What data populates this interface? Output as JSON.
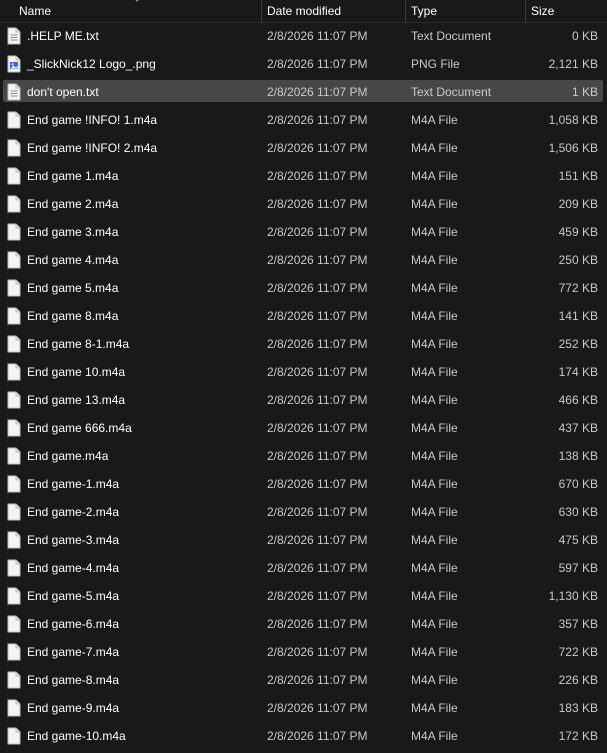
{
  "columns": {
    "name": "Name",
    "date": "Date modified",
    "type": "Type",
    "size": "Size"
  },
  "files": [
    {
      "name": ".HELP ME.txt",
      "date": "2/8/2026 11:07 PM",
      "type": "Text Document",
      "size": "0 KB",
      "icon": "text-file-icon"
    },
    {
      "name": "_SlickNick12 Logo_.png",
      "date": "2/8/2026 11:07 PM",
      "type": "PNG File",
      "size": "2,121 KB",
      "icon": "image-file-icon"
    },
    {
      "name": "don't open.txt",
      "date": "2/8/2026 11:07 PM",
      "type": "Text Document",
      "size": "1 KB",
      "icon": "text-file-icon",
      "selected": true
    },
    {
      "name": "End game !INFO! 1.m4a",
      "date": "2/8/2026 11:07 PM",
      "type": "M4A File",
      "size": "1,058 KB",
      "icon": "file-icon"
    },
    {
      "name": "End game !INFO! 2.m4a",
      "date": "2/8/2026 11:07 PM",
      "type": "M4A File",
      "size": "1,506 KB",
      "icon": "file-icon"
    },
    {
      "name": "End game 1.m4a",
      "date": "2/8/2026 11:07 PM",
      "type": "M4A File",
      "size": "151 KB",
      "icon": "file-icon"
    },
    {
      "name": "End game 2.m4a",
      "date": "2/8/2026 11:07 PM",
      "type": "M4A File",
      "size": "209 KB",
      "icon": "file-icon"
    },
    {
      "name": "End game 3.m4a",
      "date": "2/8/2026 11:07 PM",
      "type": "M4A File",
      "size": "459 KB",
      "icon": "file-icon"
    },
    {
      "name": "End game 4.m4a",
      "date": "2/8/2026 11:07 PM",
      "type": "M4A File",
      "size": "250 KB",
      "icon": "file-icon"
    },
    {
      "name": "End game 5.m4a",
      "date": "2/8/2026 11:07 PM",
      "type": "M4A File",
      "size": "772 KB",
      "icon": "file-icon"
    },
    {
      "name": "End game 8.m4a",
      "date": "2/8/2026 11:07 PM",
      "type": "M4A File",
      "size": "141 KB",
      "icon": "file-icon"
    },
    {
      "name": "End game 8-1.m4a",
      "date": "2/8/2026 11:07 PM",
      "type": "M4A File",
      "size": "252 KB",
      "icon": "file-icon"
    },
    {
      "name": "End game 10.m4a",
      "date": "2/8/2026 11:07 PM",
      "type": "M4A File",
      "size": "174 KB",
      "icon": "file-icon"
    },
    {
      "name": "End game 13.m4a",
      "date": "2/8/2026 11:07 PM",
      "type": "M4A File",
      "size": "466 KB",
      "icon": "file-icon"
    },
    {
      "name": "End game 666.m4a",
      "date": "2/8/2026 11:07 PM",
      "type": "M4A File",
      "size": "437 KB",
      "icon": "file-icon"
    },
    {
      "name": "End game.m4a",
      "date": "2/8/2026 11:07 PM",
      "type": "M4A File",
      "size": "138 KB",
      "icon": "file-icon"
    },
    {
      "name": "End game-1.m4a",
      "date": "2/8/2026 11:07 PM",
      "type": "M4A File",
      "size": "670 KB",
      "icon": "file-icon"
    },
    {
      "name": "End game-2.m4a",
      "date": "2/8/2026 11:07 PM",
      "type": "M4A File",
      "size": "630 KB",
      "icon": "file-icon"
    },
    {
      "name": "End game-3.m4a",
      "date": "2/8/2026 11:07 PM",
      "type": "M4A File",
      "size": "475 KB",
      "icon": "file-icon"
    },
    {
      "name": "End game-4.m4a",
      "date": "2/8/2026 11:07 PM",
      "type": "M4A File",
      "size": "597 KB",
      "icon": "file-icon"
    },
    {
      "name": "End game-5.m4a",
      "date": "2/8/2026 11:07 PM",
      "type": "M4A File",
      "size": "1,130 KB",
      "icon": "file-icon"
    },
    {
      "name": "End game-6.m4a",
      "date": "2/8/2026 11:07 PM",
      "type": "M4A File",
      "size": "357 KB",
      "icon": "file-icon"
    },
    {
      "name": "End game-7.m4a",
      "date": "2/8/2026 11:07 PM",
      "type": "M4A File",
      "size": "722 KB",
      "icon": "file-icon"
    },
    {
      "name": "End game-8.m4a",
      "date": "2/8/2026 11:07 PM",
      "type": "M4A File",
      "size": "226 KB",
      "icon": "file-icon"
    },
    {
      "name": "End game-9.m4a",
      "date": "2/8/2026 11:07 PM",
      "type": "M4A File",
      "size": "183 KB",
      "icon": "file-icon"
    },
    {
      "name": "End game-10.m4a",
      "date": "2/8/2026 11:07 PM",
      "type": "M4A File",
      "size": "172 KB",
      "icon": "file-icon"
    }
  ],
  "colors": {
    "background": "#191919",
    "selected_row": "#474747",
    "secondary_text": "#c9c9c9",
    "image_icon_accent": "#2d6fd6"
  }
}
